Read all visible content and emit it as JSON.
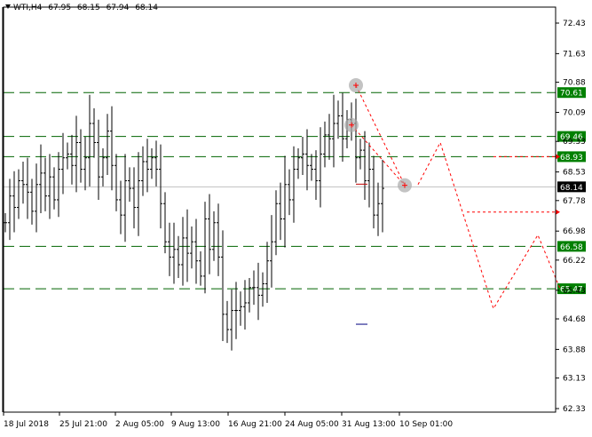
{
  "header": {
    "symbol_timeframe": "WTI,H4",
    "open": "67.95",
    "high": "68.15",
    "low": "67.94",
    "close": "68.14"
  },
  "colors": {
    "background": "#ffffff",
    "candles": "#000000",
    "level_lines": "#006400",
    "level_label_bg": "#008000",
    "current_price_line": "#c0c0c0",
    "forecast": "#ff0000",
    "markers": "#a9a9a9"
  },
  "chart_data": {
    "type": "ohlc-bar",
    "y_ticks": [
      72.43,
      71.63,
      70.88,
      70.09,
      69.33,
      68.53,
      67.78,
      66.98,
      66.22,
      65.43,
      64.68,
      63.88,
      63.13,
      62.33
    ],
    "ylim": [
      62.33,
      72.43
    ],
    "x_labels": [
      "18 Jul 2018",
      "25 Jul 21:00",
      "2 Aug 05:00",
      "9 Aug 13:00",
      "16 Aug 21:00",
      "24 Aug 05:00",
      "31 Aug 13:00",
      "10 Sep 01:00"
    ],
    "levels": [
      {
        "value": 70.61,
        "label": "70.61"
      },
      {
        "value": 69.46,
        "label": "69.46"
      },
      {
        "value": 68.93,
        "label": "68.93"
      },
      {
        "value": 66.58,
        "label": "66.58"
      },
      {
        "value": 65.47,
        "label": "65.47"
      }
    ],
    "current_price": {
      "value": 68.14,
      "label": "68.14"
    },
    "price_series": [
      67.2,
      67.9,
      67.6,
      68.3,
      68.2,
      68.0,
      67.5,
      68.2,
      68.5,
      67.9,
      68.4,
      67.8,
      68.6,
      68.9,
      69.0,
      68.7,
      69.3,
      68.6,
      68.9,
      69.8,
      69.3,
      68.4,
      68.9,
      69.6,
      68.7,
      67.8,
      67.4,
      68.3,
      68.1,
      67.6,
      68.3,
      68.8,
      68.6,
      68.9,
      68.6,
      67.7,
      66.7,
      66.3,
      66.5,
      66.1,
      66.8,
      66.4,
      66.7,
      66.2,
      65.8,
      67.3,
      66.5,
      67.2,
      66.3,
      64.8,
      64.4,
      64.9,
      64.9,
      65.0,
      65.1,
      65.5,
      65.5,
      65.3,
      65.6,
      66.2,
      66.7,
      67.7,
      67.3,
      68.2,
      67.8,
      68.6,
      68.9,
      69.0,
      68.7,
      68.6,
      68.3,
      69.0,
      69.5,
      69.4,
      69.8,
      70.0,
      69.4,
      69.9,
      69.8,
      68.9,
      69.1,
      68.3,
      68.6,
      67.4,
      67.7,
      68.1
    ],
    "markers": [
      {
        "x_index": 79,
        "value": 70.8
      },
      {
        "x_index": 78,
        "value": 69.76
      },
      {
        "x_index": 90,
        "value": 68.18
      }
    ],
    "trend_line": [
      {
        "x_index": 79,
        "value": 70.8
      },
      {
        "x_index": 90,
        "value": 68.18
      }
    ],
    "trend_line_2": [
      {
        "x_index": 78,
        "value": 69.76
      },
      {
        "x_index": 90,
        "value": 68.18
      }
    ],
    "forecast_path": [
      {
        "x_index": 93,
        "value": 68.2
      },
      {
        "x_index": 98,
        "value": 69.3
      },
      {
        "x_index": 110,
        "value": 64.95
      },
      {
        "x_index": 120,
        "value": 66.88
      },
      {
        "x_index": 125,
        "value": 65.47
      }
    ],
    "arrows": [
      {
        "from_x_index": 110,
        "to_x_index": 124,
        "value": 68.93
      },
      {
        "from_x_index": 104,
        "to_x_index": 124,
        "value": 67.48
      }
    ],
    "short_ticks": [
      {
        "x_index": 79,
        "value": 68.21,
        "color": "#c00000"
      },
      {
        "x_index": 79,
        "value": 64.54,
        "color": "#000080"
      }
    ]
  }
}
